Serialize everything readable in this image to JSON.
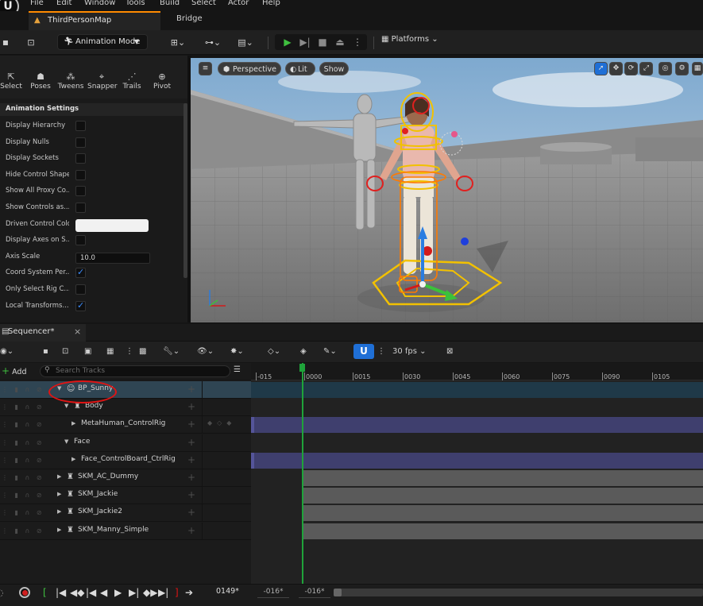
{
  "menu": [
    "File",
    "Edit",
    "Window",
    "Tools",
    "Build",
    "Select",
    "Actor",
    "Help"
  ],
  "tabs": {
    "map": "ThirdPersonMap",
    "bridge": "Bridge"
  },
  "toolbar": {
    "mode": "Animation Mode",
    "platforms": "Platforms"
  },
  "tools": [
    {
      "label": "Select",
      "icon": "select-icon",
      "glyph": "⇱"
    },
    {
      "label": "Poses",
      "icon": "poses-icon",
      "glyph": "☗"
    },
    {
      "label": "Tweens",
      "icon": "tweens-icon",
      "glyph": "⁂"
    },
    {
      "label": "Snapper",
      "icon": "snapper-icon",
      "glyph": "⌖"
    },
    {
      "label": "Trails",
      "icon": "trails-icon",
      "glyph": "⋰"
    },
    {
      "label": "Pivot",
      "icon": "pivot-icon",
      "glyph": "⊕"
    }
  ],
  "animation_settings": {
    "header": "Animation Settings",
    "rows": [
      {
        "label": "Display Hierarchy",
        "type": "checkbox",
        "checked": false
      },
      {
        "label": "Display Nulls",
        "type": "checkbox",
        "checked": false
      },
      {
        "label": "Display Sockets",
        "type": "checkbox",
        "checked": false
      },
      {
        "label": "Hide Control Shapes",
        "type": "checkbox",
        "checked": false
      },
      {
        "label": "Show All Proxy Co...",
        "type": "checkbox",
        "checked": false
      },
      {
        "label": "Show Controls as...",
        "type": "checkbox",
        "checked": false
      },
      {
        "label": "Driven Control Color",
        "type": "color",
        "color": "#f1f1f1"
      },
      {
        "label": "Display Axes on S...",
        "type": "checkbox",
        "checked": false
      },
      {
        "label": "Axis Scale",
        "type": "number",
        "value": "10.0"
      },
      {
        "label": "Coord System Per...",
        "type": "checkbox",
        "checked": true
      },
      {
        "label": "Only Select Rig C...",
        "type": "checkbox",
        "checked": false
      },
      {
        "label": "Local Transforms...",
        "type": "checkbox",
        "checked": true
      }
    ]
  },
  "viewport": {
    "perspective": "Perspective",
    "lit": "Lit",
    "show": "Show"
  },
  "sequencer": {
    "tab": "Sequencer*",
    "fps": "30 fps",
    "add": "Add",
    "search_placeholder": "Search Tracks",
    "ticks": [
      "-015",
      "0000",
      "0015",
      "0030",
      "0045",
      "0060",
      "0075",
      "0090",
      "0105"
    ],
    "tracks": [
      {
        "label": "BP_Sunny",
        "indent": 0,
        "expanded": true,
        "icon": "blueprint-actor-icon",
        "selected": true,
        "lane": "selected"
      },
      {
        "label": "Body",
        "indent": 1,
        "expanded": true,
        "icon": "skeletal-mesh-icon",
        "lane": "empty"
      },
      {
        "label": "MetaHuman_ControlRig",
        "indent": 2,
        "expanded": false,
        "icon": "",
        "lane": "purple",
        "keys": true
      },
      {
        "label": "Face",
        "indent": 1,
        "expanded": true,
        "icon": "",
        "lane": "empty"
      },
      {
        "label": "Face_ControlBoard_CtrlRig",
        "indent": 2,
        "expanded": false,
        "icon": "",
        "lane": "purple"
      },
      {
        "label": "SKM_AC_Dummy",
        "indent": 0,
        "expanded": false,
        "icon": "skeletal-mesh-icon",
        "lane": "grey"
      },
      {
        "label": "SKM_Jackie",
        "indent": 0,
        "expanded": false,
        "icon": "skeletal-mesh-icon",
        "lane": "grey"
      },
      {
        "label": "SKM_Jackie2",
        "indent": 0,
        "expanded": false,
        "icon": "skeletal-mesh-icon",
        "lane": "grey"
      },
      {
        "label": "SKM_Manny_Simple",
        "indent": 0,
        "expanded": false,
        "icon": "skeletal-mesh-icon",
        "lane": "grey"
      }
    ],
    "current_frame": "0149*",
    "start_frame": "-016*",
    "end_frame": "-016*"
  },
  "colors": {
    "accent": "#ff8a00",
    "play_green": "#3fbf3f",
    "snap_blue": "#1f6fd6",
    "playhead": "#1fa33a",
    "annotation_red": "#e01414",
    "lane_purple": "#3f3f6e",
    "lane_grey": "#5a5a5a",
    "lane_selected": "#1f3948"
  }
}
